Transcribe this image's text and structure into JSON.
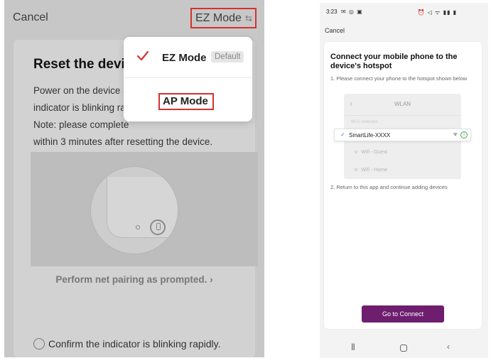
{
  "left_screen": {
    "cancel_label": "Cancel",
    "mode_selector": {
      "label": "EZ Mode",
      "icon": "swap-icon"
    },
    "reset_title": "Reset the devic",
    "reset_desc_lines": [
      "Power on the device a",
      "indicator is blinking rapi",
      "Note: please complete",
      "within 3 minutes after resetting the device."
    ],
    "pairing_link": "Perform net pairing as prompted. ›",
    "confirm_label": "Confirm the indicator is blinking rapidly.",
    "dropdown": {
      "ez_label": "EZ Mode",
      "ez_badge": "Default",
      "ap_label": "AP Mode"
    },
    "accent_color": "#d3322f"
  },
  "right_screen": {
    "status_time": "3:23",
    "cancel_label": "Cancel",
    "title": "Connect your mobile phone to the device's hotspot",
    "step1": "1. Please connect your phone to the hotspot shown below",
    "wlan": {
      "title": "WLAN",
      "subtitle": "Wi-fi networks",
      "networks": [
        "Wifi - Guest",
        "Wifi - Home"
      ],
      "hotspot": "SmartLife-XXXX"
    },
    "step2": "2. Return to this app and continue adding devices",
    "connect_button": "Go to Connect",
    "button_color": "#6f1e6f"
  }
}
